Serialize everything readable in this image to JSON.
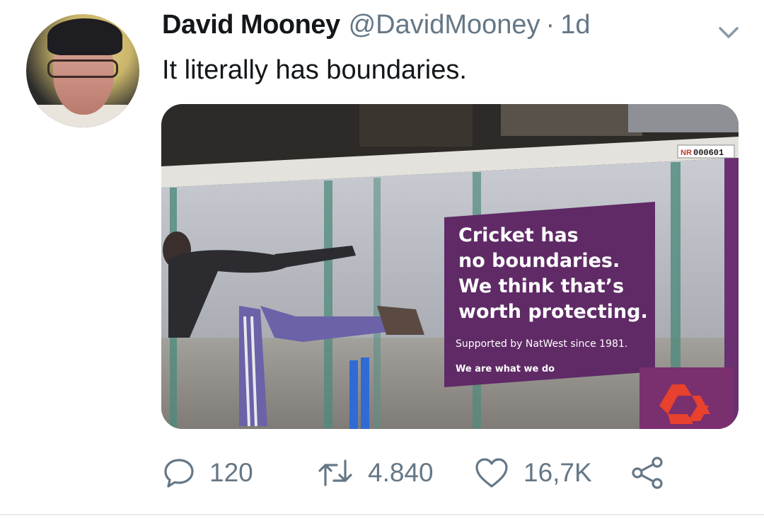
{
  "tweet": {
    "display_name": "David Mooney",
    "handle": "@DavidMooney",
    "separator": "·",
    "timestamp": "1d",
    "text": "It literally has boundaries."
  },
  "media": {
    "billboard_text": {
      "headline_line1": "Cricket has",
      "headline_line2": "no boundaries.",
      "headline_line3": "We think that’s",
      "headline_line4": "worth protecting.",
      "supported": "Supported by NatWest since 1981.",
      "tagline": "We are what we do",
      "plate_prefix": "NR",
      "plate_number": "000601"
    }
  },
  "actions": {
    "reply_count": "120",
    "retweet_count": "4.840",
    "like_count": "16,7K"
  },
  "icons": {
    "more": "chevron-down-icon",
    "reply": "speech-bubble-icon",
    "retweet": "retweet-arrows-icon",
    "like": "heart-icon",
    "share": "share-icon"
  },
  "colors": {
    "text": "#14171a",
    "secondary": "#657786",
    "billboard_purple": "#5f2a66",
    "natwest_red": "#e8412d"
  }
}
